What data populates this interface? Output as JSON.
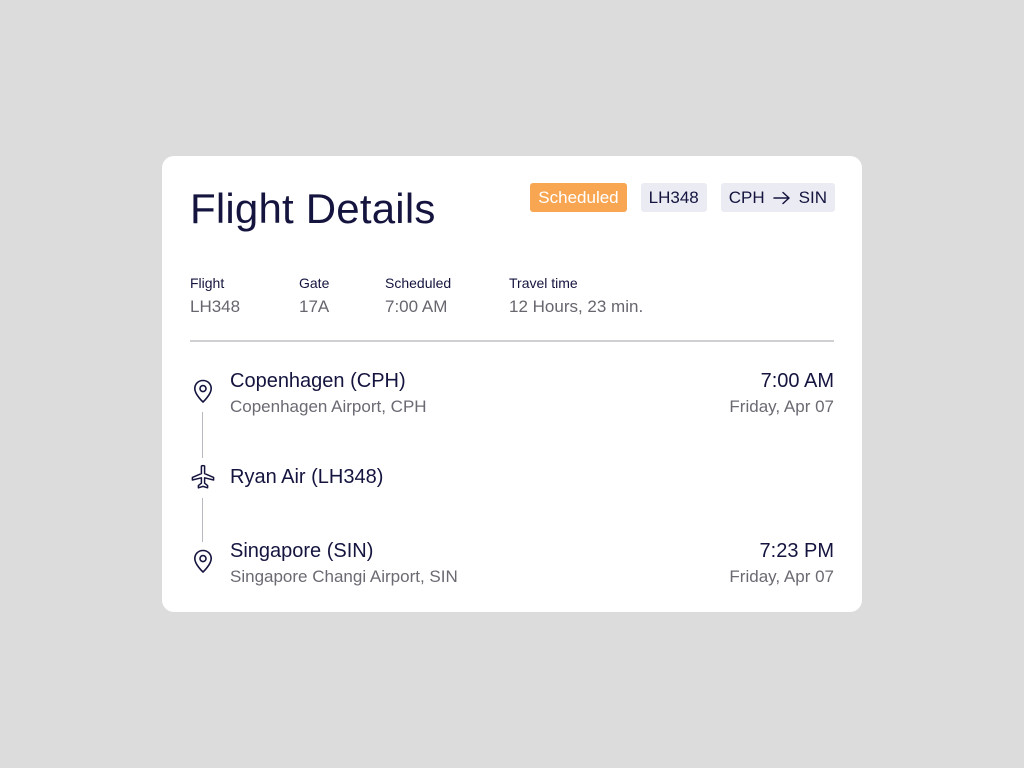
{
  "card": {
    "title": "Flight Details",
    "badges": {
      "status": "Scheduled",
      "flight": "LH348",
      "route_from": "CPH",
      "route_to": "SIN"
    },
    "meta": [
      {
        "label": "Flight",
        "value": "LH348"
      },
      {
        "label": "Gate",
        "value": "17A"
      },
      {
        "label": "Scheduled",
        "value": "7:00 AM"
      },
      {
        "label": "Travel time",
        "value": "12 Hours, 23 min."
      }
    ],
    "departure": {
      "place": "Copenhagen (CPH)",
      "airport": "Copenhagen Airport, CPH",
      "time": "7:00 AM",
      "date": "Friday, Apr 07"
    },
    "carrier": {
      "name": "Ryan Air (LH348)"
    },
    "arrival": {
      "place": "Singapore (SIN)",
      "airport": "Singapore Changi Airport, SIN",
      "time": "7:23 PM",
      "date": "Friday, Apr 07"
    }
  },
  "colors": {
    "background": "#dcdcdc",
    "card": "#ffffff",
    "text_primary": "#14143f",
    "text_secondary": "#66666f",
    "status_badge": "#f9a653",
    "grey_badge": "#ebebf3"
  },
  "icons": {
    "status": "none",
    "route_arrow": "arrow-right-icon",
    "departure": "map-pin-icon",
    "carrier": "airplane-icon",
    "arrival": "map-pin-icon"
  }
}
